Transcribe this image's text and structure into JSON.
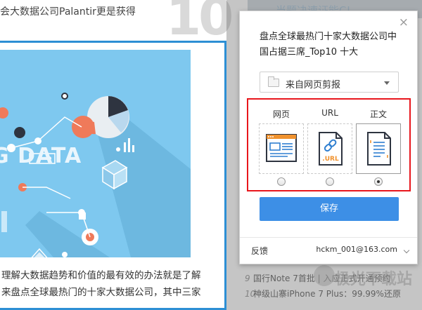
{
  "background": {
    "top_text": "会大数据公司Palantir更是获得",
    "big_number": "10",
    "top_right_text": "当题决速证能C!",
    "hero_title": "G DATA",
    "body_lines": [
      "理解大数据趋势和价值的最有效的办法就是了解",
      "来盘点全球最热门的十家大数据公司，其中三家"
    ],
    "right_list": [
      {
        "num": "9",
        "text": "国行Note 7首批 | 入应正式开通预约"
      },
      {
        "num": "10",
        "text": "神级山寨iPhone 7 Plus：99.99%还原"
      }
    ],
    "watermark": "极光下载站"
  },
  "dialog": {
    "close_glyph": "×",
    "title": "盘点全球最热门十家大数据公司中国占据三席_Top10 十大",
    "notebook_select": "来自网页剪报",
    "modes": [
      {
        "label": "网页",
        "selected": false,
        "icon": "webpage-icon"
      },
      {
        "label": "URL",
        "selected": false,
        "icon": "url-link-icon",
        "icon_text": ".URL"
      },
      {
        "label": "正文",
        "selected": true,
        "icon": "article-text-icon"
      }
    ],
    "save_label": "保存",
    "feedback_label": "反馈",
    "account": "hckm_001@163.com"
  },
  "colors": {
    "accent_blue": "#3d8fe6",
    "highlight_red": "#e8161c",
    "hero_bg": "#7ec8ef",
    "icon_blue": "#2f7fd0",
    "icon_orange": "#f0922e"
  }
}
